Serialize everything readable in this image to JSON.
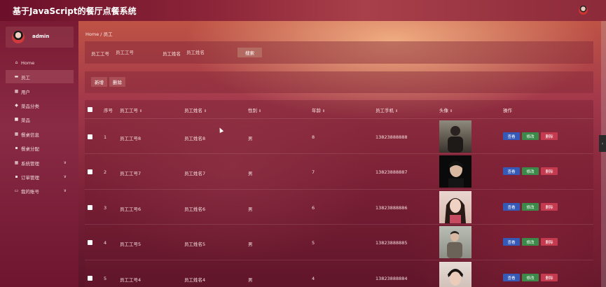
{
  "app": {
    "title": "基于JavaScript的餐厅点餐系统"
  },
  "user": {
    "name": "admin"
  },
  "sidebar": {
    "items": [
      {
        "label": "Home",
        "icon": "home-icon",
        "active": false,
        "has_children": false
      },
      {
        "label": "员工",
        "icon": "id-card-icon",
        "active": true,
        "has_children": false
      },
      {
        "label": "用户",
        "icon": "grid-icon",
        "active": false,
        "has_children": false
      },
      {
        "label": "菜品分类",
        "icon": "tag-icon",
        "active": false,
        "has_children": false
      },
      {
        "label": "菜品",
        "icon": "dish-icon",
        "active": false,
        "has_children": false
      },
      {
        "label": "餐桌信息",
        "icon": "grid-icon",
        "active": false,
        "has_children": false
      },
      {
        "label": "餐桌分配",
        "icon": "chat-icon",
        "active": false,
        "has_children": false
      },
      {
        "label": "系统管理",
        "icon": "grid-icon",
        "active": false,
        "has_children": true
      },
      {
        "label": "订单管理",
        "icon": "chat-icon",
        "active": false,
        "has_children": true
      },
      {
        "label": "我的账号",
        "icon": "card-icon",
        "active": false,
        "has_children": true
      }
    ]
  },
  "breadcrumb": {
    "home": "Home",
    "separator": "/",
    "current": "员工"
  },
  "search": {
    "id_label": "员工工号",
    "id_placeholder": "员工工号",
    "name_label": "员工姓名",
    "name_placeholder": "员工姓名",
    "button": "搜索"
  },
  "actions": {
    "add": "新增",
    "delete": "删除"
  },
  "table": {
    "headers": {
      "index": "序号",
      "emp_id": "员工工号",
      "emp_name": "员工姓名",
      "gender": "性别",
      "age": "年龄",
      "phone": "员工手机",
      "avatar": "头像",
      "ops": "操作"
    },
    "row_buttons": {
      "view": "查看",
      "edit": "修改",
      "delete": "删除"
    },
    "rows": [
      {
        "index": "1",
        "emp_id": "员工工号8",
        "emp_name": "员工姓名8",
        "gender": "男",
        "age": "8",
        "phone": "13823888888"
      },
      {
        "index": "2",
        "emp_id": "员工工号7",
        "emp_name": "员工姓名7",
        "gender": "男",
        "age": "7",
        "phone": "13823888887"
      },
      {
        "index": "3",
        "emp_id": "员工工号6",
        "emp_name": "员工姓名6",
        "gender": "男",
        "age": "6",
        "phone": "13823888886"
      },
      {
        "index": "4",
        "emp_id": "员工工号5",
        "emp_name": "员工姓名5",
        "gender": "男",
        "age": "5",
        "phone": "13823888885"
      },
      {
        "index": "5",
        "emp_id": "员工工号4",
        "emp_name": "员工姓名4",
        "gender": "男",
        "age": "4",
        "phone": "13823888884"
      }
    ]
  }
}
